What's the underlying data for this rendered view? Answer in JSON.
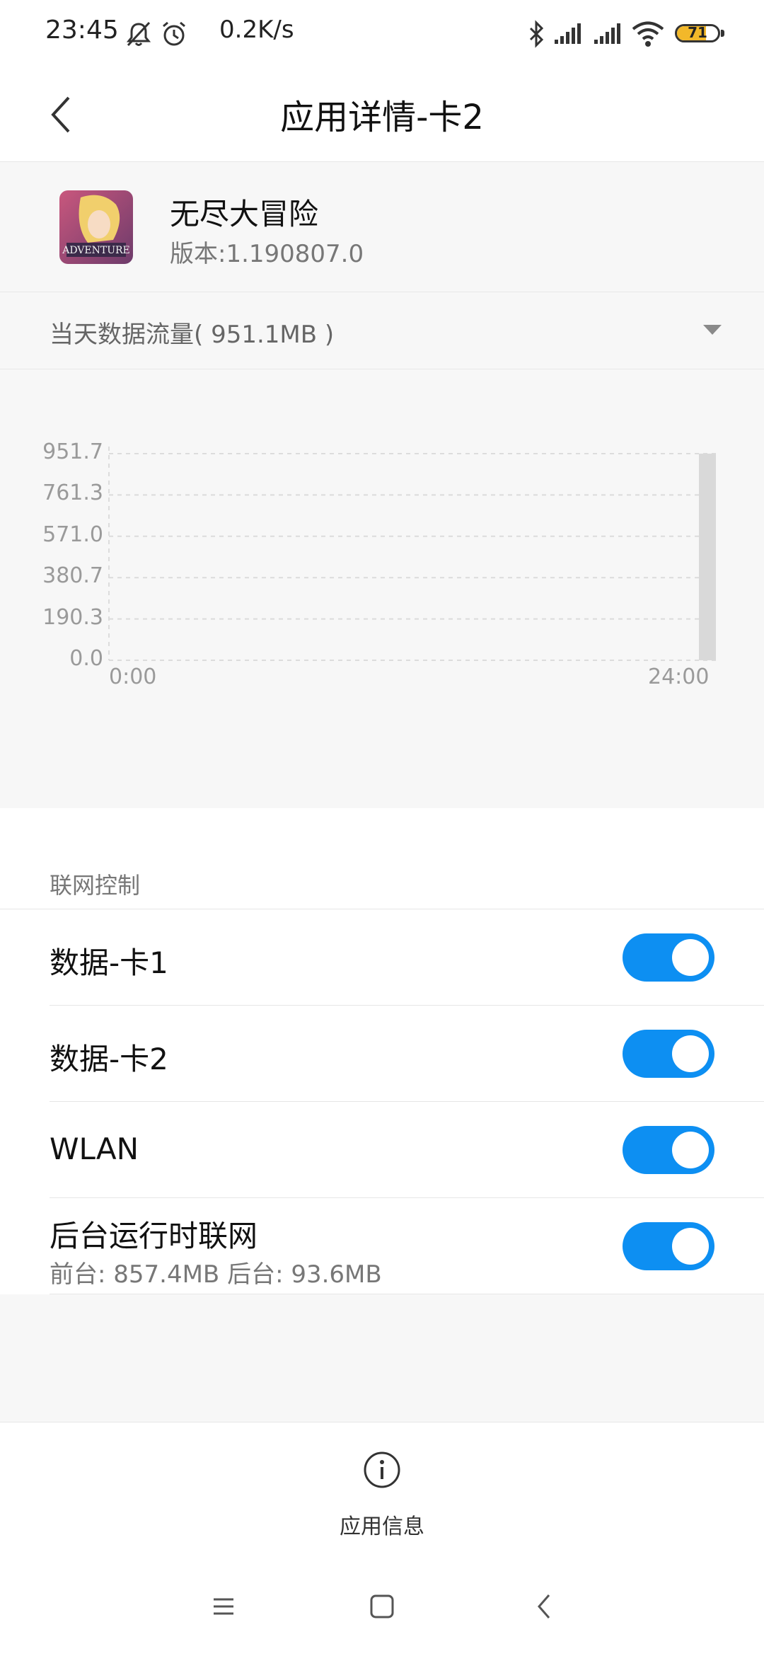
{
  "status_bar": {
    "time": "23:45",
    "speed": "0.2K/s",
    "battery": "71",
    "battery_level": 71,
    "icons": [
      "mute-icon",
      "alarm-icon",
      "bluetooth-icon",
      "signal-icon",
      "signal-icon",
      "wifi-icon",
      "battery-icon"
    ]
  },
  "header": {
    "title": "应用详情-卡2"
  },
  "app": {
    "name": "无尽大冒险",
    "version": "版本:1.190807.0"
  },
  "traffic": {
    "label": "当天数据流量( 951.1MB )"
  },
  "chart_data": {
    "type": "bar",
    "x": [
      24
    ],
    "values": [
      951.7
    ],
    "yticks": [
      "951.7",
      "761.3",
      "571.0",
      "380.7",
      "190.3",
      "0.0"
    ],
    "xticks": [
      "0:00",
      "24:00"
    ],
    "ylim": [
      0,
      951.7
    ],
    "xlim": [
      0,
      24
    ],
    "grid": true,
    "bar_color": "#d9d9d9"
  },
  "network_control": {
    "section_label": "联网控制",
    "items": [
      {
        "label": "数据-卡1",
        "enabled": true
      },
      {
        "label": "数据-卡2",
        "enabled": true
      },
      {
        "label": "WLAN",
        "enabled": true
      },
      {
        "label": "后台运行时联网",
        "sub": "前台: 857.4MB  后台: 93.6MB",
        "enabled": true
      }
    ]
  },
  "footer": {
    "app_info_label": "应用信息"
  },
  "colors": {
    "accent": "#0d8ff2",
    "background_grey": "#f7f7f7",
    "battery": "#f2b82a"
  }
}
